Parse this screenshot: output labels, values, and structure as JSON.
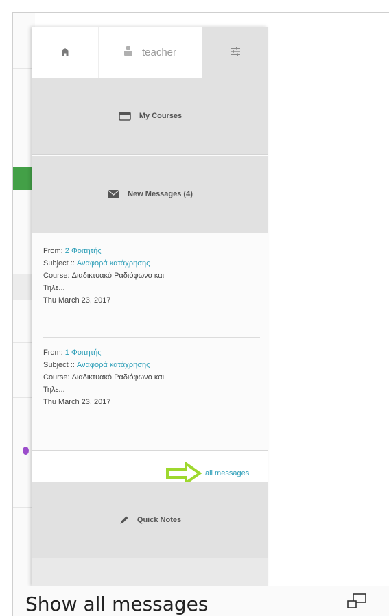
{
  "nav": {
    "home_icon": "home-icon",
    "user_icon": "user-icon",
    "user_label": "teacher",
    "settings_icon": "sliders-icon"
  },
  "sections": {
    "courses_label": "My Courses",
    "courses_icon": "window-icon",
    "messages_label": "New Messages (4)",
    "messages_icon": "envelope-icon",
    "notes_label": "Quick Notes",
    "notes_icon": "pencil-icon"
  },
  "messages": [
    {
      "from_label": "From:",
      "from_value": "2 Φοιτητής",
      "subject_label": "Subject ::",
      "subject_value": "Αναφορά κατάχρησης",
      "course_label": "Course:",
      "course_value": "Διαδικτυακό Ραδιόφωνο και",
      "course_cont": "Τηλε...",
      "date": "Thu March 23, 2017"
    },
    {
      "from_label": "From:",
      "from_value": "1 Φοιτητής",
      "subject_label": "Subject ::",
      "subject_value": "Αναφορά κατάχρησης",
      "course_label": "Course:",
      "course_value": "Διαδικτυακό Ραδιόφωνο και",
      "course_cont": "Τηλε...",
      "date": "Thu March 23, 2017"
    }
  ],
  "all_messages_label": "all messages",
  "arrow_icon": "arrow-right-icon",
  "caption": {
    "text": "Show all messages",
    "icon": "expand-icon"
  },
  "colors": {
    "link": "#2a9db7",
    "arrow": "#9ed82e",
    "section_bg": "#e1e1e1",
    "green_button": "#43a047"
  }
}
